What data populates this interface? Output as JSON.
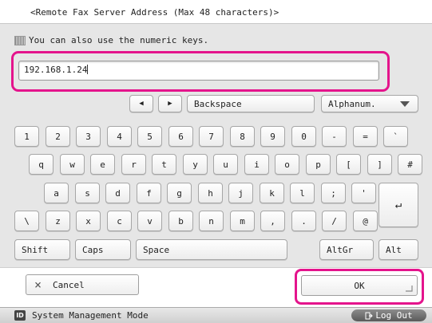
{
  "header": {
    "title": "<Remote Fax Server Address (Max 48 characters)>"
  },
  "hint": {
    "text": "You can also use the numeric keys."
  },
  "input": {
    "value": "192.168.1.24"
  },
  "nav": {
    "left_arrow": "◀",
    "right_arrow": "▶",
    "backspace": "Backspace",
    "mode_value": "Alphanum."
  },
  "keys": {
    "row1": [
      "1",
      "2",
      "3",
      "4",
      "5",
      "6",
      "7",
      "8",
      "9",
      "0",
      "-",
      "=",
      "`"
    ],
    "row2": [
      "q",
      "w",
      "e",
      "r",
      "t",
      "y",
      "u",
      "i",
      "o",
      "p",
      "[",
      "]",
      "#"
    ],
    "row3": [
      "a",
      "s",
      "d",
      "f",
      "g",
      "h",
      "j",
      "k",
      "l",
      ";",
      "'"
    ],
    "row4": [
      "\\",
      "z",
      "x",
      "c",
      "v",
      "b",
      "n",
      "m",
      ",",
      ".",
      "/",
      "@"
    ],
    "enter": "↵",
    "shift": "Shift",
    "caps": "Caps",
    "space": "Space",
    "altgr": "AltGr",
    "alt": "Alt"
  },
  "actions": {
    "cancel": "Cancel",
    "cancel_icon": "×",
    "ok": "OK"
  },
  "status": {
    "mode": "System Management Mode",
    "id_icon": "ID",
    "logout": "Log Out"
  },
  "colors": {
    "highlight": "#e4148c"
  }
}
